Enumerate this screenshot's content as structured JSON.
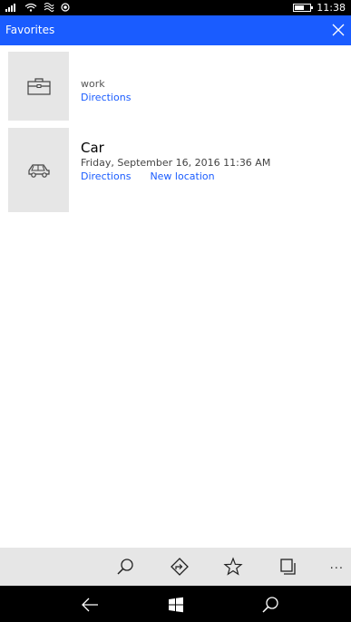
{
  "status_bar": {
    "time": "11:38",
    "battery_level": 0.6,
    "icons": [
      "signal-icon",
      "wifi-icon",
      "data-sense-icon",
      "location-icon"
    ]
  },
  "header": {
    "title": "Favorites",
    "accent_color": "#1a5cff"
  },
  "favorites": [
    {
      "name": "work",
      "icon": "briefcase-icon",
      "links": [
        "Directions"
      ]
    },
    {
      "name": "Car",
      "icon": "car-icon",
      "date": "Friday, September 16, 2016 11:36 AM",
      "links": [
        "Directions",
        "New location"
      ]
    }
  ],
  "app_bar": {
    "buttons": [
      "search-icon",
      "directions-icon",
      "favorites-star-icon",
      "layers-icon"
    ],
    "more": "..."
  },
  "nav_bar": {
    "buttons": [
      "back-icon",
      "windows-start-icon",
      "search-icon"
    ]
  }
}
